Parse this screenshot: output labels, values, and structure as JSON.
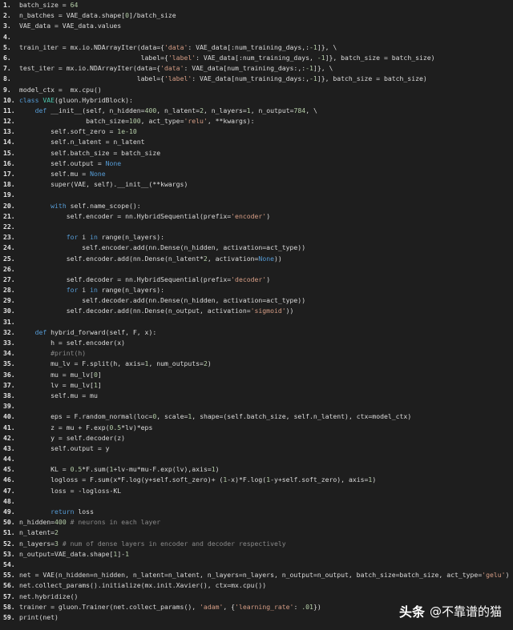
{
  "lines": [
    [
      {
        "t": "batch_size = "
      },
      {
        "t": "64",
        "c": "n"
      }
    ],
    [
      {
        "t": "n_batches = VAE_data.shape["
      },
      {
        "t": "0",
        "c": "n"
      },
      {
        "t": "]/batch_size"
      }
    ],
    [
      {
        "t": "VAE_data = VAE_data.values"
      }
    ],
    [],
    [
      {
        "t": "train_iter = mx.io.NDArrayIter(data={"
      },
      {
        "t": "'data'",
        "c": "s"
      },
      {
        "t": ": VAE_data[:num_training_days,:"
      },
      {
        "t": "-1",
        "c": "n"
      },
      {
        "t": "]}, \\"
      }
    ],
    [
      {
        "t": "                               label={"
      },
      {
        "t": "'label'",
        "c": "s"
      },
      {
        "t": ": VAE_data[:num_training_days, "
      },
      {
        "t": "-1",
        "c": "n"
      },
      {
        "t": "]}, batch_size = batch_size)"
      }
    ],
    [
      {
        "t": "test_iter = mx.io.NDArrayIter(data={"
      },
      {
        "t": "'data'",
        "c": "s"
      },
      {
        "t": ": VAE_data[num_training_days:,:"
      },
      {
        "t": "-1",
        "c": "n"
      },
      {
        "t": "]}, \\"
      }
    ],
    [
      {
        "t": "                              label={"
      },
      {
        "t": "'label'",
        "c": "s"
      },
      {
        "t": ": VAE_data[num_training_days:,"
      },
      {
        "t": "-1",
        "c": "n"
      },
      {
        "t": "]}, batch_size = batch_size)"
      }
    ],
    [
      {
        "t": "model_ctx =  mx.cpu()"
      }
    ],
    [
      {
        "t": "class ",
        "c": "k"
      },
      {
        "t": "VAE",
        "c": "cl"
      },
      {
        "t": "(gluon.HybridBlock):"
      }
    ],
    [
      {
        "t": "    "
      },
      {
        "t": "def ",
        "c": "k"
      },
      {
        "t": "__init__(self, n_hidden="
      },
      {
        "t": "400",
        "c": "n"
      },
      {
        "t": ", n_latent="
      },
      {
        "t": "2",
        "c": "n"
      },
      {
        "t": ", n_layers="
      },
      {
        "t": "1",
        "c": "n"
      },
      {
        "t": ", n_output="
      },
      {
        "t": "784",
        "c": "n"
      },
      {
        "t": ", \\"
      }
    ],
    [
      {
        "t": "                 batch_size="
      },
      {
        "t": "100",
        "c": "n"
      },
      {
        "t": ", act_type="
      },
      {
        "t": "'relu'",
        "c": "s"
      },
      {
        "t": ", **kwargs):"
      }
    ],
    [
      {
        "t": "        self.soft_zero = "
      },
      {
        "t": "1e-10",
        "c": "n"
      }
    ],
    [
      {
        "t": "        self.n_latent = n_latent"
      }
    ],
    [
      {
        "t": "        self.batch_size = batch_size"
      }
    ],
    [
      {
        "t": "        self.output = "
      },
      {
        "t": "None",
        "c": "k"
      }
    ],
    [
      {
        "t": "        self.mu = "
      },
      {
        "t": "None",
        "c": "k"
      }
    ],
    [
      {
        "t": "        super(VAE, self).__init__(**kwargs)"
      }
    ],
    [],
    [
      {
        "t": "        "
      },
      {
        "t": "with ",
        "c": "k"
      },
      {
        "t": "self.name_scope():"
      }
    ],
    [
      {
        "t": "            self.encoder = nn.HybridSequential(prefix="
      },
      {
        "t": "'encoder'",
        "c": "s"
      },
      {
        "t": ")"
      }
    ],
    [],
    [
      {
        "t": "            "
      },
      {
        "t": "for ",
        "c": "k"
      },
      {
        "t": "i "
      },
      {
        "t": "in ",
        "c": "k"
      },
      {
        "t": "range(n_layers):"
      }
    ],
    [
      {
        "t": "                self.encoder.add(nn.Dense(n_hidden, activation=act_type))"
      }
    ],
    [
      {
        "t": "            self.encoder.add(nn.Dense(n_latent*"
      },
      {
        "t": "2",
        "c": "n"
      },
      {
        "t": ", activation="
      },
      {
        "t": "None",
        "c": "k"
      },
      {
        "t": "))"
      }
    ],
    [],
    [
      {
        "t": "            self.decoder = nn.HybridSequential(prefix="
      },
      {
        "t": "'decoder'",
        "c": "s"
      },
      {
        "t": ")"
      }
    ],
    [
      {
        "t": "            "
      },
      {
        "t": "for ",
        "c": "k"
      },
      {
        "t": "i "
      },
      {
        "t": "in ",
        "c": "k"
      },
      {
        "t": "range(n_layers):"
      }
    ],
    [
      {
        "t": "                self.decoder.add(nn.Dense(n_hidden, activation=act_type))"
      }
    ],
    [
      {
        "t": "            self.decoder.add(nn.Dense(n_output, activation="
      },
      {
        "t": "'sigmoid'",
        "c": "s"
      },
      {
        "t": "))"
      }
    ],
    [],
    [
      {
        "t": "    "
      },
      {
        "t": "def ",
        "c": "k"
      },
      {
        "t": "hybrid_forward(self, F, x):"
      }
    ],
    [
      {
        "t": "        h = self.encoder(x)"
      }
    ],
    [
      {
        "t": "        "
      },
      {
        "t": "#print(h)",
        "c": "c"
      }
    ],
    [
      {
        "t": "        mu_lv = F.split(h, axis="
      },
      {
        "t": "1",
        "c": "n"
      },
      {
        "t": ", num_outputs="
      },
      {
        "t": "2",
        "c": "n"
      },
      {
        "t": ")"
      }
    ],
    [
      {
        "t": "        mu = mu_lv["
      },
      {
        "t": "0",
        "c": "n"
      },
      {
        "t": "]"
      }
    ],
    [
      {
        "t": "        lv = mu_lv["
      },
      {
        "t": "1",
        "c": "n"
      },
      {
        "t": "]"
      }
    ],
    [
      {
        "t": "        self.mu = mu"
      }
    ],
    [],
    [
      {
        "t": "        eps = F.random_normal(loc="
      },
      {
        "t": "0",
        "c": "n"
      },
      {
        "t": ", scale="
      },
      {
        "t": "1",
        "c": "n"
      },
      {
        "t": ", shape=(self.batch_size, self.n_latent), ctx=model_ctx)"
      }
    ],
    [
      {
        "t": "        z = mu + F.exp("
      },
      {
        "t": "0.5",
        "c": "n"
      },
      {
        "t": "*lv)*eps"
      }
    ],
    [
      {
        "t": "        y = self.decoder(z)"
      }
    ],
    [
      {
        "t": "        self.output = y"
      }
    ],
    [],
    [
      {
        "t": "        KL = "
      },
      {
        "t": "0.5",
        "c": "n"
      },
      {
        "t": "*F.sum("
      },
      {
        "t": "1",
        "c": "n"
      },
      {
        "t": "+lv-mu*mu-F.exp(lv),axis="
      },
      {
        "t": "1",
        "c": "n"
      },
      {
        "t": ")"
      }
    ],
    [
      {
        "t": "        logloss = F.sum(x*F.log(y+self.soft_zero)+ ("
      },
      {
        "t": "1",
        "c": "n"
      },
      {
        "t": "-x)*F.log("
      },
      {
        "t": "1",
        "c": "n"
      },
      {
        "t": "-y+self.soft_zero), axis="
      },
      {
        "t": "1",
        "c": "n"
      },
      {
        "t": ")"
      }
    ],
    [
      {
        "t": "        loss = -logloss-KL"
      }
    ],
    [],
    [
      {
        "t": "        "
      },
      {
        "t": "return ",
        "c": "k"
      },
      {
        "t": "loss"
      }
    ],
    [
      {
        "t": "n_hidden="
      },
      {
        "t": "400",
        "c": "n"
      },
      {
        "t": " "
      },
      {
        "t": "# neurons in each layer",
        "c": "c"
      }
    ],
    [
      {
        "t": "n_latent="
      },
      {
        "t": "2",
        "c": "n"
      }
    ],
    [
      {
        "t": "n_layers="
      },
      {
        "t": "3",
        "c": "n"
      },
      {
        "t": " "
      },
      {
        "t": "# num of dense layers in encoder and decoder respectively",
        "c": "c"
      }
    ],
    [
      {
        "t": "n_output=VAE_data.shape["
      },
      {
        "t": "1",
        "c": "n"
      },
      {
        "t": "]-"
      },
      {
        "t": "1",
        "c": "n"
      }
    ],
    [],
    [
      {
        "t": "net = VAE(n_hidden=n_hidden, n_latent=n_latent, n_layers=n_layers, n_output=n_output, batch_size=batch_size, act_type="
      },
      {
        "t": "'gelu'",
        "c": "s"
      },
      {
        "t": ")"
      }
    ],
    [
      {
        "t": "net.collect_params().initialize(mx.init.Xavier(), ctx=mx.cpu())"
      }
    ],
    [
      {
        "t": "net.hybridize()"
      }
    ],
    [
      {
        "t": "trainer = gluon.Trainer(net.collect_params(), "
      },
      {
        "t": "'adam'",
        "c": "s"
      },
      {
        "t": ", {"
      },
      {
        "t": "'learning_rate'",
        "c": "s"
      },
      {
        "t": ": "
      },
      {
        "t": ".01",
        "c": "n"
      },
      {
        "t": "})"
      }
    ],
    [
      {
        "t": "print(net)"
      }
    ]
  ],
  "watermark": {
    "brand": "头条",
    "handle": "@不靠谱的猫"
  }
}
